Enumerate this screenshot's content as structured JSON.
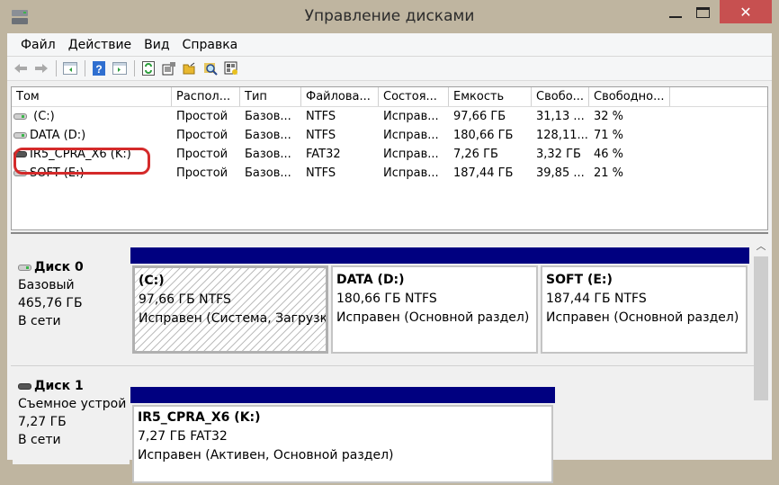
{
  "window": {
    "title": "Управление дисками",
    "close_glyph": "✕"
  },
  "menu": [
    "Файл",
    "Действие",
    "Вид",
    "Справка"
  ],
  "toolbar": {
    "buttons": [
      "back-icon",
      "forward-icon",
      "show-hide-console-tree-icon",
      "help-icon",
      "show-hide-action-pane-icon",
      "refresh-icon",
      "properties-icon",
      "open-icon",
      "explore-icon",
      "settings-icon"
    ]
  },
  "volumes": {
    "columns": [
      "Том",
      "Распол...",
      "Тип",
      "Файлова...",
      "Состоя...",
      "Емкость",
      "Свобо...",
      "Свободно..."
    ],
    "rows": [
      {
        "name": " (C:)",
        "layout": "Простой",
        "type": "Базов...",
        "fs": "NTFS",
        "status": "Исправ...",
        "capacity": "97,66 ГБ",
        "free": "31,13 ...",
        "free_pct": "32 %",
        "removable": false
      },
      {
        "name": "DATA (D:)",
        "layout": "Простой",
        "type": "Базов...",
        "fs": "NTFS",
        "status": "Исправ...",
        "capacity": "180,66 ГБ",
        "free": "128,11...",
        "free_pct": "71 %",
        "removable": false
      },
      {
        "name": "IR5_CPRA_X6 (K:)",
        "layout": "Простой",
        "type": "Базов...",
        "fs": "FAT32",
        "status": "Исправ...",
        "capacity": "7,26 ГБ",
        "free": "3,32 ГБ",
        "free_pct": "46 %",
        "removable": true
      },
      {
        "name": "SOFT (E:)",
        "layout": "Простой",
        "type": "Базов...",
        "fs": "NTFS",
        "status": "Исправ...",
        "capacity": "187,44 ГБ",
        "free": "39,85 ...",
        "free_pct": "21 %",
        "removable": false
      }
    ]
  },
  "disks": [
    {
      "name": "Диск 0",
      "kind": "Базовый",
      "size": "465,76 ГБ",
      "state": "В сети",
      "partitions": [
        {
          "title": " (C:)",
          "size_fs": "97,66 ГБ NTFS",
          "status": "Исправен (Система, Загрузка,",
          "selected": true
        },
        {
          "title": "DATA  (D:)",
          "size_fs": "180,66 ГБ NTFS",
          "status": "Исправен (Основной раздел)",
          "selected": false
        },
        {
          "title": "SOFT  (E:)",
          "size_fs": "187,44 ГБ NTFS",
          "status": "Исправен (Основной раздел)",
          "selected": false
        }
      ]
    },
    {
      "name": "Диск 1",
      "kind": "Съемное устрой",
      "size": "7,27 ГБ",
      "state": "В сети",
      "partitions": [
        {
          "title": "IR5_CPRA_X6  (K:)",
          "size_fs": "7,27 ГБ FAT32",
          "status": "Исправен (Активен, Основной раздел)",
          "selected": false
        }
      ]
    }
  ],
  "colors": {
    "partition_bar": "#000080",
    "highlight": "#d42a2a",
    "close_button": "#c75050"
  }
}
